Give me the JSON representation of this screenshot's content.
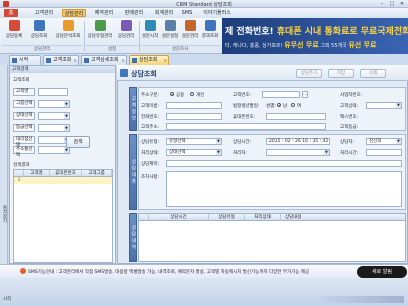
{
  "window": {
    "title": "CRM Standard 상담조회",
    "controls": [
      "–",
      "□",
      "✕"
    ]
  },
  "menu": [
    {
      "label": "홈"
    },
    {
      "label": "고객관리"
    },
    {
      "label": "상담관리",
      "active": true
    },
    {
      "label": "예약관리"
    },
    {
      "label": "판매관리"
    },
    {
      "label": "회계관리"
    },
    {
      "label": "SMS"
    },
    {
      "label": "이야기플러스"
    }
  ],
  "ribbon": {
    "buttons": [
      {
        "label": "상담등록",
        "icon": "consult-add-icon",
        "color": "#d64a3a"
      },
      {
        "label": "상담조회",
        "icon": "consult-search-icon",
        "color": "#3f74be"
      },
      {
        "label": "상담분석조회",
        "icon": "consult-analysis-icon",
        "color": "#e79b2a"
      },
      {
        "label": "상담유형관리",
        "icon": "consult-type-icon",
        "color": "#4f9a4a"
      },
      {
        "label": "상담관리",
        "icon": "consult-manage-icon",
        "color": "#7a5bb4"
      },
      {
        "label": "설문시작",
        "icon": "survey-start-icon",
        "color": "#2e8bb8"
      },
      {
        "label": "설문설정",
        "icon": "survey-settings-icon",
        "color": "#5c7fa8"
      },
      {
        "label": "설문관리",
        "icon": "survey-manage-icon",
        "color": "#c2662a"
      },
      {
        "label": "결과조회",
        "icon": "result-search-icon",
        "color": "#3f74be"
      }
    ],
    "groups": [
      "상담관리",
      "설정",
      "설문조사"
    ]
  },
  "ad": {
    "line1_a": "제 전화번호!",
    "line1_b": "휴대폰 시내 통화료",
    "line1_c": "로 무료국제전화",
    "line2_a": "타, 캐나다, 홍콩, 싱가포르!",
    "line2_b": "유무선 무료",
    "line2_c": "그외 55개국",
    "line2_d": "유선 무료"
  },
  "tabs": [
    {
      "label": "시작"
    },
    {
      "label": "고객조회"
    },
    {
      "label": "고객상세조회"
    },
    {
      "label": "상담조회",
      "active": true
    }
  ],
  "sidebar": {
    "label": "즐겨찾기"
  },
  "left_panel": {
    "header": "고객검색",
    "subheader": "고객조회",
    "filters": [
      {
        "label": "고객명",
        "type": "input",
        "value": ""
      },
      {
        "label": "그룹선택",
        "type": "select",
        "value": ""
      },
      {
        "label": "상태선택",
        "type": "select",
        "value": ""
      },
      {
        "label": "등급선택",
        "type": "select",
        "value": ""
      },
      {
        "label": "대리점선택",
        "type": "select",
        "value": ""
      },
      {
        "label": "주소통선택",
        "type": "select",
        "value": ""
      }
    ],
    "search_button": "검색",
    "results_header": "검색결과",
    "columns": [
      "고객명",
      "휴대폰번호",
      "고객그룹"
    ],
    "rows": [
      {
        "index": "1",
        "name": "",
        "phone": "",
        "group": ""
      }
    ]
  },
  "main": {
    "title": "상담조회",
    "actions": [
      "상담추가",
      "저장",
      "삭제"
    ],
    "customer_section": {
      "label": "고객정보",
      "address_type_label": "주소구분:",
      "address_type_options": [
        "공용",
        "개인"
      ],
      "address_type_selected": "공용",
      "customer_no_label": "고객번호:",
      "customer_name_label": "고객이름:",
      "phone_label": "전화번호:",
      "business_no_label": "사업자번호:",
      "registration_label": "법정생년월일:",
      "gender_label": "성별:",
      "gender_options": [
        "남",
        "여"
      ],
      "gender_selected": "남",
      "mobile_label": "휴대폰번호:",
      "fax_label": "팩스번호:",
      "address_label": "고객주소:",
      "customer_status_label": "고객상태:",
      "email_label": "이메일:",
      "customer_grade_label": "고객등급:"
    },
    "consult_section": {
      "label": "상담내용",
      "consult_type_label": "상담유형:",
      "consult_type_value": "유형선택",
      "consult_time_label": "상담시간:",
      "consult_time_value": "2015 - 02 - 26   16 : 35 : 42",
      "consultant_label": "상담자:",
      "consultant_value": "김선희",
      "status_label": "처리상태:",
      "status_value": "상태선택",
      "handler_label": "처리자:",
      "handled_time_label": "처리시간:",
      "consult_subject_label": "상담제목:",
      "memo_label": "조치사항:"
    },
    "history_section": {
      "label": "상담내역",
      "columns": [
        "상담시간",
        "상담유형",
        "처리상태",
        "상담내용"
      ]
    }
  },
  "info_bar": {
    "text": "SMS기능안내 : 고객관리에서 직접 SMS발송, 대용량 엑셀발송 가능, 내역조회, 예약문자 발송, 고객별 자동메시지 발신기능까지 다양한 부가기능 제공",
    "badge": "새로 알림"
  },
  "status_bar": {
    "text": "시작"
  }
}
